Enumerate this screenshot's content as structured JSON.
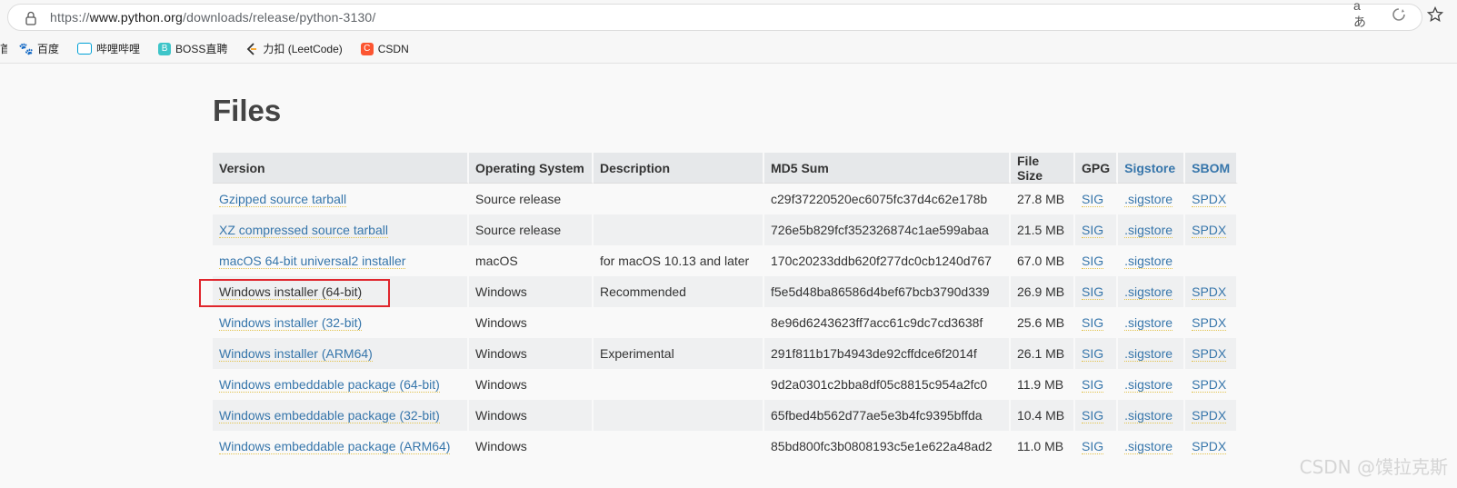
{
  "browser": {
    "url_prefix": "https://",
    "url_host": "www.python.org",
    "url_path": "/downloads/release/python-3130/",
    "icons": [
      "lock-icon",
      "read-aloud-icon",
      "refresh-icon",
      "star-icon"
    ],
    "read_aloud_label": "aあ"
  },
  "bookmarks": [
    {
      "label": "百度",
      "icon": "baidu-icon",
      "color": "#2932e1"
    },
    {
      "label": "哔哩哔哩",
      "icon": "bilibili-icon",
      "color": "#00a1d6"
    },
    {
      "label": "BOSS直聘",
      "icon": "boss-icon",
      "color": "#3ec5c9",
      "glyph": "B"
    },
    {
      "label": "力扣 (LeetCode)",
      "icon": "leetcode-icon",
      "color": "#f89f1b"
    },
    {
      "label": "CSDN",
      "icon": "csdn-icon",
      "color": "#fc5531",
      "glyph": "C"
    }
  ],
  "page": {
    "title": "Files",
    "headers": [
      "Version",
      "Operating System",
      "Description",
      "MD5 Sum",
      "File Size",
      "GPG",
      "Sigstore",
      "SBOM"
    ],
    "rows": [
      {
        "version": "Gzipped source tarball",
        "os": "Source release",
        "desc": "",
        "md5": "c29f37220520ec6075fc37d4c62e178b",
        "size": "27.8 MB",
        "gpg": "SIG",
        "sig": ".sigstore",
        "sbom": "SPDX"
      },
      {
        "version": "XZ compressed source tarball",
        "os": "Source release",
        "desc": "",
        "md5": "726e5b829fcf352326874c1ae599abaa",
        "size": "21.5 MB",
        "gpg": "SIG",
        "sig": ".sigstore",
        "sbom": "SPDX"
      },
      {
        "version": "macOS 64-bit universal2 installer",
        "os": "macOS",
        "desc": "for macOS 10.13 and later",
        "md5": "170c20233ddb620f277dc0cb1240d767",
        "size": "67.0 MB",
        "gpg": "SIG",
        "sig": ".sigstore",
        "sbom": ""
      },
      {
        "version": "Windows installer (64-bit)",
        "os": "Windows",
        "desc": "Recommended",
        "md5": "f5e5d48ba86586d4bef67bcb3790d339",
        "size": "26.9 MB",
        "gpg": "SIG",
        "sig": ".sigstore",
        "sbom": "SPDX"
      },
      {
        "version": "Windows installer (32-bit)",
        "os": "Windows",
        "desc": "",
        "md5": "8e96d6243623ff7acc61c9dc7cd3638f",
        "size": "25.6 MB",
        "gpg": "SIG",
        "sig": ".sigstore",
        "sbom": "SPDX"
      },
      {
        "version": "Windows installer (ARM64)",
        "os": "Windows",
        "desc": "Experimental",
        "md5": "291f811b17b4943de92cffdce6f2014f",
        "size": "26.1 MB",
        "gpg": "SIG",
        "sig": ".sigstore",
        "sbom": "SPDX"
      },
      {
        "version": "Windows embeddable package (64-bit)",
        "os": "Windows",
        "desc": "",
        "md5": "9d2a0301c2bba8df05c8815c954a2fc0",
        "size": "11.9 MB",
        "gpg": "SIG",
        "sig": ".sigstore",
        "sbom": "SPDX"
      },
      {
        "version": "Windows embeddable package (32-bit)",
        "os": "Windows",
        "desc": "",
        "md5": "65fbed4b562d77ae5e3b4fc9395bffda",
        "size": "10.4 MB",
        "gpg": "SIG",
        "sig": ".sigstore",
        "sbom": "SPDX"
      },
      {
        "version": "Windows embeddable package (ARM64)",
        "os": "Windows",
        "desc": "",
        "md5": "85bd800fc3b0808193c5e1e622a48ad2",
        "size": "11.0 MB",
        "gpg": "SIG",
        "sig": ".sigstore",
        "sbom": "SPDX"
      }
    ],
    "highlight_color": "#e0262d",
    "link_color": "#3776ab"
  },
  "watermark": "CSDN @馍拉克斯"
}
